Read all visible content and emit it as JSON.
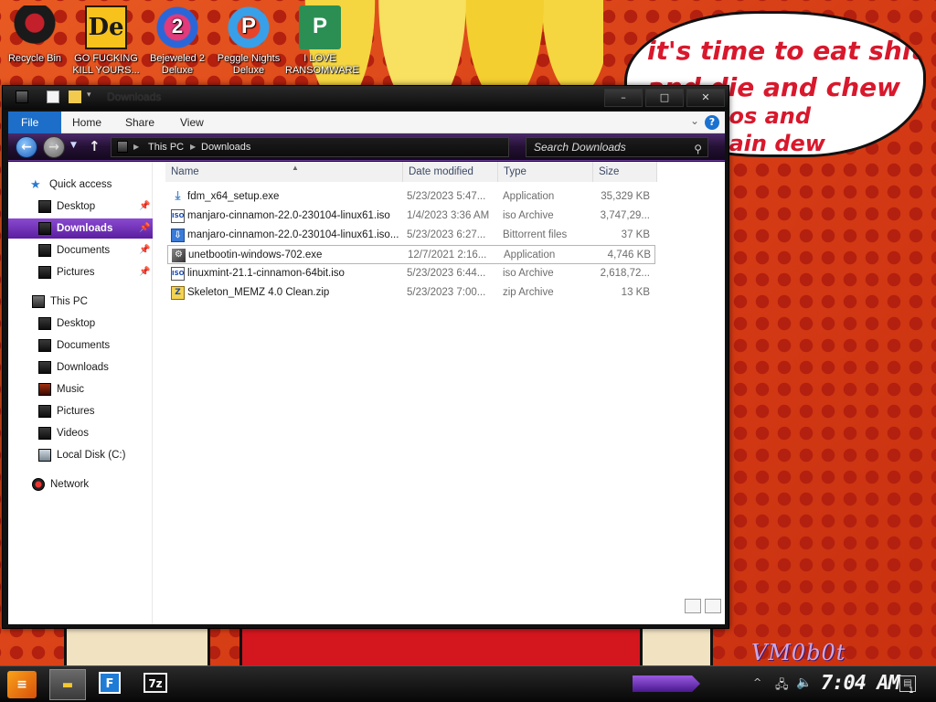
{
  "desktop": {
    "icons": [
      {
        "label": "Recycle Bin",
        "icon": "recycle-bin-icon"
      },
      {
        "label": "GO FUCKING KILL YOURS...",
        "icon": "de-game-icon"
      },
      {
        "label": "Bejeweled 2 Deluxe",
        "icon": "bejeweled-icon"
      },
      {
        "label": "Peggle Nights Deluxe",
        "icon": "peggle-icon"
      },
      {
        "label": "I LOVE RANSOMWARE",
        "icon": "publisher-icon"
      }
    ],
    "speech_bubble": [
      "it's time to eat shit",
      "and die and chew",
      "tos and",
      "tain dew"
    ],
    "watermark": "VM0b0t"
  },
  "window": {
    "title": "Downloads",
    "controls": {
      "minimize": "–",
      "maximize": "□",
      "close": "✕"
    },
    "ribbon_tabs": [
      "File",
      "Home",
      "Share",
      "View"
    ],
    "help": "?",
    "address": {
      "segments": [
        "This PC",
        "Downloads"
      ]
    },
    "search_placeholder": "Search Downloads",
    "sidebar": {
      "quick_access": "Quick access",
      "quick_items": [
        {
          "label": "Desktop",
          "pinned": true
        },
        {
          "label": "Downloads",
          "pinned": true,
          "selected": true
        },
        {
          "label": "Documents",
          "pinned": true
        },
        {
          "label": "Pictures",
          "pinned": true
        }
      ],
      "this_pc": "This PC",
      "pc_items": [
        "Desktop",
        "Documents",
        "Downloads",
        "Music",
        "Pictures",
        "Videos",
        "Local Disk (C:)"
      ],
      "network": "Network"
    },
    "columns": {
      "name": "Name",
      "date": "Date modified",
      "type": "Type",
      "size": "Size"
    },
    "files": [
      {
        "name": "fdm_x64_setup.exe",
        "date": "5/23/2023 5:47...",
        "type": "Application",
        "size": "35,329 KB",
        "icon": "installer-icon"
      },
      {
        "name": "manjaro-cinnamon-22.0-230104-linux61.iso",
        "date": "1/4/2023 3:36 AM",
        "type": "iso Archive",
        "size": "3,747,29...",
        "icon": "iso-icon"
      },
      {
        "name": "manjaro-cinnamon-22.0-230104-linux61.iso...",
        "date": "5/23/2023 6:27...",
        "type": "Bittorrent files",
        "size": "37 KB",
        "icon": "torrent-icon"
      },
      {
        "name": "unetbootin-windows-702.exe",
        "date": "12/7/2021 2:16...",
        "type": "Application",
        "size": "4,746 KB",
        "icon": "unetbootin-icon"
      },
      {
        "name": "linuxmint-21.1-cinnamon-64bit.iso",
        "date": "5/23/2023 6:44...",
        "type": "iso Archive",
        "size": "2,618,72...",
        "icon": "iso-icon"
      },
      {
        "name": "Skeleton_MEMZ 4.0 Clean.zip",
        "date": "5/23/2023 7:00...",
        "type": "zip Archive",
        "size": "13 KB",
        "icon": "zip-icon"
      }
    ]
  },
  "taskbar": {
    "clock": "7:04 AM",
    "notification_count": "1",
    "tasks": [
      "File Explorer",
      "Free Download Manager",
      "7-Zip"
    ]
  }
}
